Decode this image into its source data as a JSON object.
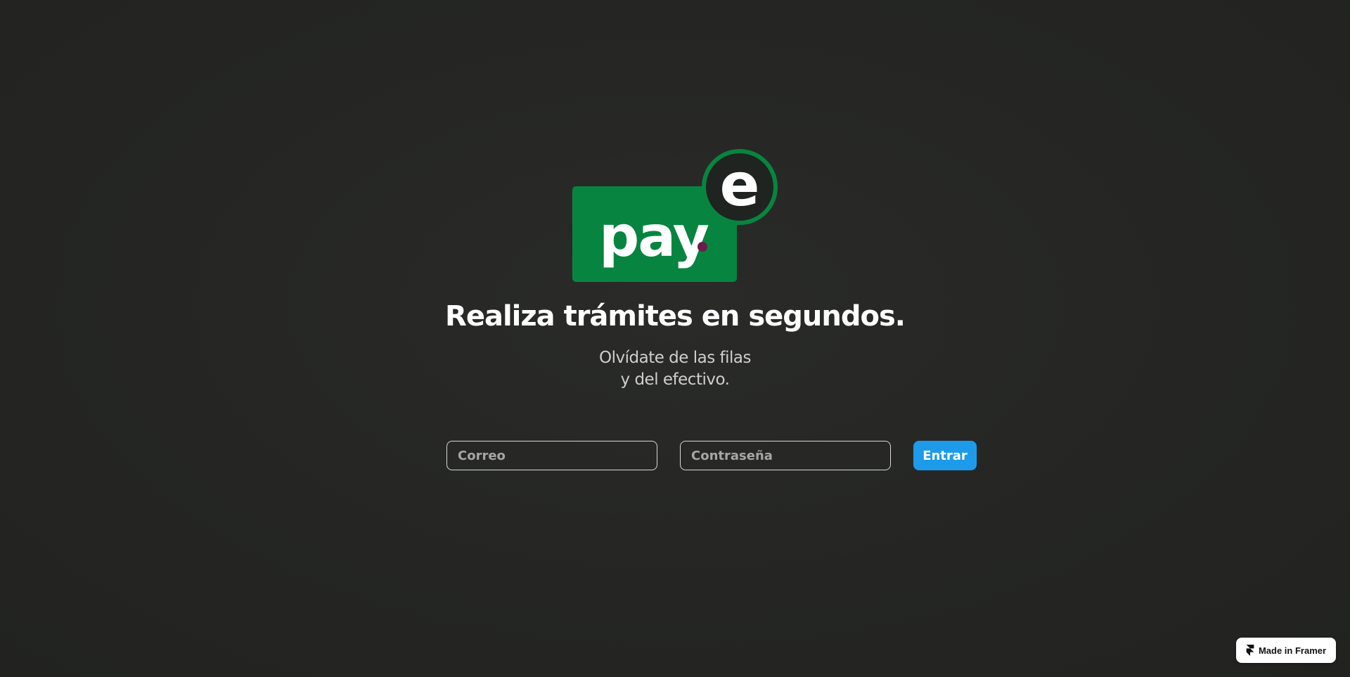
{
  "logo": {
    "word": "pay",
    "letter": "e",
    "colors": {
      "green": "#078540",
      "accent_dot": "#6b1e4b",
      "circle": "#1f2420"
    }
  },
  "hero": {
    "headline": "Realiza trámites en segundos.",
    "subline_1": "Olvídate de las filas",
    "subline_2": "y del efectivo."
  },
  "form": {
    "email_placeholder": "Correo",
    "email_value": "",
    "password_placeholder": "Contraseña",
    "password_value": "",
    "submit_label": "Entrar",
    "submit_color": "#1d9bea"
  },
  "badge": {
    "label": "Made in Framer",
    "icon": "framer-icon"
  },
  "theme": {
    "background": "#252624",
    "text": "#ffffff"
  }
}
